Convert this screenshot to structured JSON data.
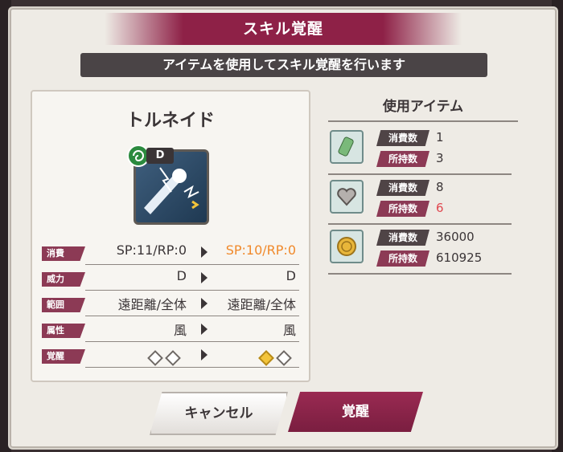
{
  "dialog": {
    "title": "スキル覚醒",
    "subtitle": "アイテムを使用してスキル覚醒を行います"
  },
  "skill": {
    "name": "トルネイド",
    "grade": "D",
    "element_icon": "wind-element-icon",
    "stats": [
      {
        "label": "消費",
        "old": "SP:11/RP:0",
        "new": "SP:10/RP:0",
        "changed": true
      },
      {
        "label": "威力",
        "old": "D",
        "new": "D",
        "changed": false
      },
      {
        "label": "範囲",
        "old": "遠距離/全体",
        "new": "遠距離/全体",
        "changed": false
      },
      {
        "label": "属性",
        "old": "風",
        "new": "風",
        "changed": false
      },
      {
        "label": "覚醒",
        "old_filled": 0,
        "new_filled": 1,
        "total": 2
      }
    ]
  },
  "items": {
    "header": "使用アイテム",
    "consume_label": "消費数",
    "owned_label": "所持数",
    "rows": [
      {
        "icon": "scroll-item-icon",
        "consume": "1",
        "owned": "3",
        "insufficient": false
      },
      {
        "icon": "heart-item-icon",
        "consume": "8",
        "owned": "6",
        "insufficient": true
      },
      {
        "icon": "gold-coin-icon",
        "consume": "36000",
        "owned": "610925",
        "insufficient": false
      }
    ]
  },
  "buttons": {
    "cancel": "キャンセル",
    "awaken": "覚醒"
  },
  "colors": {
    "accent": "#8e2147",
    "highlight": "#f0892b",
    "warning": "#e0474f"
  }
}
